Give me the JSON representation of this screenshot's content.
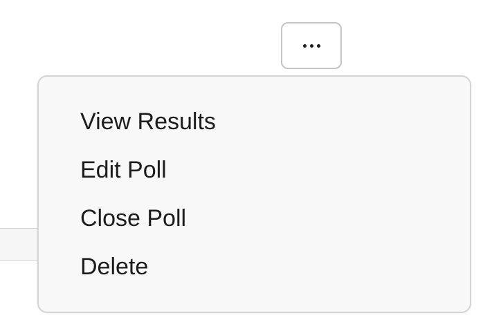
{
  "more_button": {
    "icon": "more-horizontal-icon"
  },
  "menu": {
    "items": [
      {
        "label": "View Results"
      },
      {
        "label": "Edit Poll"
      },
      {
        "label": "Close Poll"
      },
      {
        "label": "Delete"
      }
    ]
  },
  "colors": {
    "text": "#1d1c1d",
    "menu_background": "#f8f8f8",
    "border": "#d4d4d4"
  }
}
